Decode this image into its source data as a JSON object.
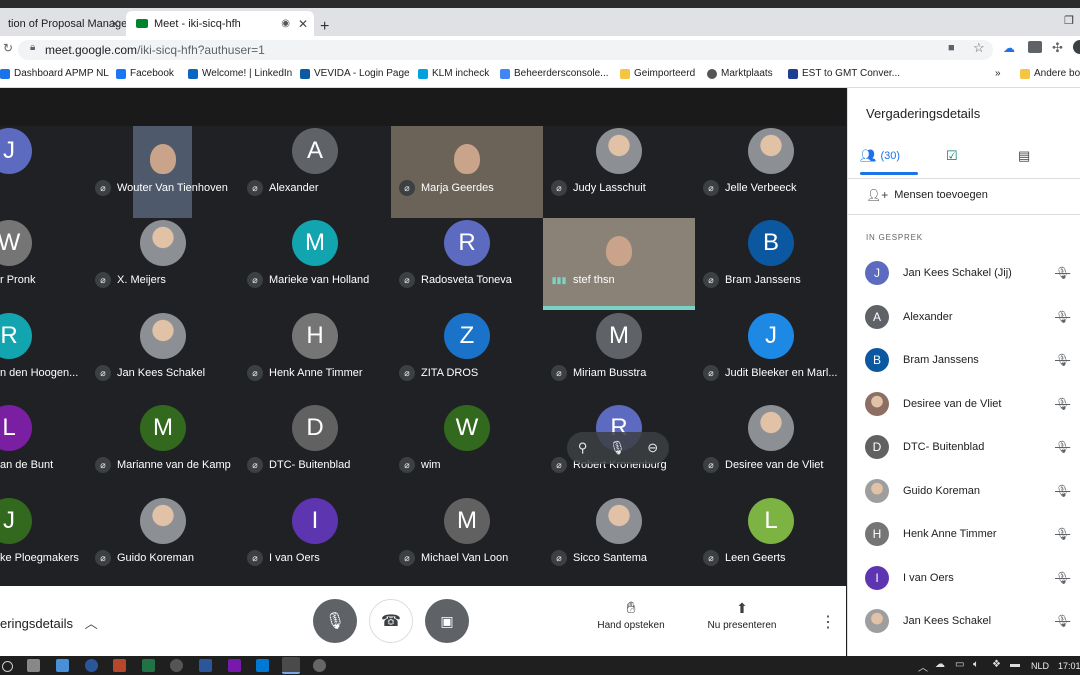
{
  "browser": {
    "tabs": [
      {
        "title": "tion of Proposal Manage",
        "active": false
      },
      {
        "title": "Meet - iki-sicq-hfh",
        "active": true
      }
    ],
    "url_host": "meet.google.com",
    "url_path": "/iki-sicq-hfh?authuser=1",
    "bookmarks": [
      {
        "label": "Dashboard APMP NL",
        "color": "#1a73e8"
      },
      {
        "label": "Facebook",
        "color": "#1877f2"
      },
      {
        "label": "Welcome! | LinkedIn",
        "color": "#0a66c2"
      },
      {
        "label": "VEVIDA - Login Page",
        "color": "#0b5aa2"
      },
      {
        "label": "KLM incheck",
        "color": "#00a1de"
      },
      {
        "label": "Beheerdersconsole...",
        "color": "#4285f4"
      },
      {
        "label": "Geimporteerd",
        "color": "#f4c542"
      },
      {
        "label": "Marktplaats",
        "color": "#555555"
      },
      {
        "label": "EST to GMT Conver...",
        "color": "#1c3f94"
      },
      {
        "label": "Andere bo",
        "color": "#f4c542"
      }
    ],
    "bookmarks_more": "»"
  },
  "grid": [
    [
      {
        "name": "",
        "initial": "J",
        "color": "#5c6bc0",
        "kind": "avatar"
      },
      {
        "name": "Wouter Van Tienhoven",
        "kind": "video"
      },
      {
        "name": "Alexander",
        "initial": "A",
        "color": "#5f6368",
        "kind": "avatar"
      },
      {
        "name": "Marja Geerdes",
        "kind": "video"
      },
      {
        "name": "Judy Lasschuit",
        "kind": "photo"
      },
      {
        "name": "Jelle Verbeeck",
        "kind": "photo"
      }
    ],
    [
      {
        "name": "r Pronk",
        "initial": "W",
        "color": "#757575",
        "kind": "avatar"
      },
      {
        "name": "X. Meijers",
        "kind": "photo"
      },
      {
        "name": "Marieke van Holland",
        "initial": "M",
        "color": "#12a4af",
        "kind": "avatar"
      },
      {
        "name": "Radosveta Toneva",
        "initial": "R",
        "color": "#5c6bc0",
        "kind": "avatar"
      },
      {
        "name": "stef thsn",
        "kind": "video"
      },
      {
        "name": "Bram Janssens",
        "initial": "B",
        "color": "#0b57a0",
        "kind": "avatar"
      }
    ],
    [
      {
        "name": "n den Hoogen...",
        "initial": "R",
        "color": "#12a4af",
        "kind": "avatar"
      },
      {
        "name": "Jan Kees Schakel",
        "kind": "photo"
      },
      {
        "name": "Henk Anne Timmer",
        "initial": "H",
        "color": "#757575",
        "kind": "avatar"
      },
      {
        "name": "ZITA DROS",
        "initial": "Z",
        "color": "#1a73c9",
        "kind": "avatar"
      },
      {
        "name": "Miriam Busstra",
        "initial": "M",
        "color": "#5f6368",
        "kind": "avatar"
      },
      {
        "name": "Judit Bleeker en Marl...",
        "initial": "J",
        "color": "#1e88e5",
        "kind": "avatar"
      }
    ],
    [
      {
        "name": "an de Bunt",
        "initial": "L",
        "color": "#7b1fa2",
        "kind": "avatar"
      },
      {
        "name": "Marianne van de Kamp",
        "initial": "M",
        "color": "#33691e",
        "kind": "avatar"
      },
      {
        "name": "DTC- Buitenblad",
        "initial": "D",
        "color": "#616161",
        "kind": "avatar"
      },
      {
        "name": "wim",
        "initial": "W",
        "color": "#33691e",
        "kind": "avatar"
      },
      {
        "name": "Robert Kronenburg",
        "initial": "R",
        "color": "#5c6bc0",
        "kind": "avatar"
      },
      {
        "name": "Desiree van de Vliet",
        "kind": "photo"
      }
    ],
    [
      {
        "name": "ke Ploegmakers",
        "initial": "J",
        "color": "#33691e",
        "kind": "avatar"
      },
      {
        "name": "Guido Koreman",
        "kind": "photo"
      },
      {
        "name": "I van Oers",
        "initial": "I",
        "color": "#5e35b1",
        "kind": "avatar"
      },
      {
        "name": "Michael Van Loon",
        "initial": "M",
        "color": "#616161",
        "kind": "avatar"
      },
      {
        "name": "Sicco Santema",
        "kind": "photo"
      },
      {
        "name": "Leen Geerts",
        "initial": "L",
        "color": "#7cb342",
        "kind": "avatar"
      }
    ]
  ],
  "bottom": {
    "details_label": "eringsdetails",
    "raise_hand": "Hand opsteken",
    "present": "Nu presenteren"
  },
  "panel": {
    "title": "Vergaderingsdetails",
    "people_count": "(30)",
    "add_people": "Mensen toevoegen",
    "section": "IN GESPREK",
    "people": [
      {
        "name": "Jan Kees Schakel (Jij)",
        "initial": "J",
        "color": "#5c6bc0",
        "photo": false
      },
      {
        "name": "Alexander",
        "initial": "A",
        "color": "#5f6368",
        "photo": false
      },
      {
        "name": "Bram Janssens",
        "initial": "B",
        "color": "#0b57a0",
        "photo": false
      },
      {
        "name": "Desiree van de Vliet",
        "initial": "",
        "color": "#8d6e63",
        "photo": true
      },
      {
        "name": "DTC- Buitenblad",
        "initial": "D",
        "color": "#616161",
        "photo": false
      },
      {
        "name": "Guido Koreman",
        "initial": "",
        "color": "#9e9e9e",
        "photo": true
      },
      {
        "name": "Henk Anne Timmer",
        "initial": "H",
        "color": "#757575",
        "photo": false
      },
      {
        "name": "I van Oers",
        "initial": "I",
        "color": "#5e35b1",
        "photo": false
      },
      {
        "name": "Jan Kees Schakel",
        "initial": "",
        "color": "#9e9e9e",
        "photo": true
      }
    ]
  },
  "taskbar": {
    "lang": "NLD",
    "time": "17:01"
  }
}
